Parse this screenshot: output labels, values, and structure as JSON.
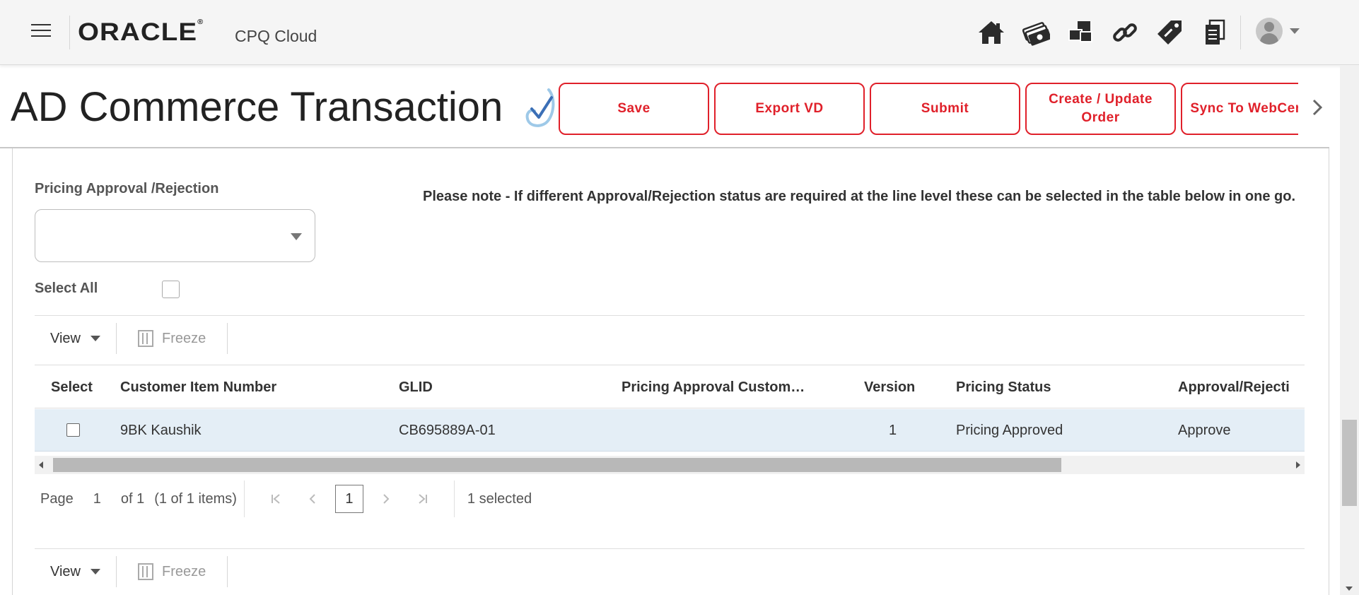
{
  "header": {
    "logo_text": "ORACLE",
    "logo_mark": "®",
    "product": "CPQ Cloud",
    "nav_icons": [
      "home-icon",
      "money-icon",
      "boxes-icon",
      "link-icon",
      "tag-icon",
      "documents-icon"
    ]
  },
  "page": {
    "title": "AD Commerce Transaction",
    "actions": [
      {
        "label": "Save"
      },
      {
        "label": "Export VD"
      },
      {
        "label": "Submit"
      },
      {
        "label": "Create / Update Order"
      },
      {
        "label": "Sync To WebCenter"
      }
    ]
  },
  "form": {
    "pricing_label": "Pricing Approval /Rejection",
    "pricing_value": "",
    "note": "Please note - If different Approval/Rejection status are required at the line level these can be selected in the table below in one go.",
    "select_all_label": "Select All"
  },
  "toolbar": {
    "view_label": "View",
    "freeze_label": "Freeze"
  },
  "table": {
    "columns": [
      "Select",
      "Customer Item Number",
      "GLID",
      "Pricing Approval Custom…",
      "Version",
      "Pricing Status",
      "Approval/Rejecti"
    ],
    "rows": [
      {
        "selected": true,
        "customer_item_number": "9BK Kaushik",
        "glid": "CB695889A-01",
        "pricing_approval_custom": "",
        "version": "1",
        "pricing_status": "Pricing Approved",
        "approval": "Approve"
      }
    ]
  },
  "pagination": {
    "page_label": "Page",
    "page_number": "1",
    "of_label": "of 1",
    "items_label": "(1 of 1 items)",
    "current_page": "1",
    "selected_label": "1 selected"
  },
  "colors": {
    "accent": "#e0202a",
    "row_highlight": "#e4eef6"
  }
}
